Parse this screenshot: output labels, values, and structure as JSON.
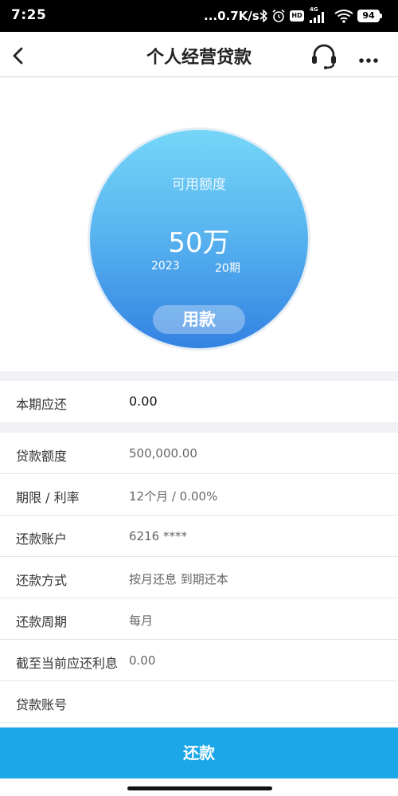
{
  "status_bar": {
    "time": "7:25",
    "net_speed": "...0.7K/s",
    "hd": "HD",
    "network": "4G",
    "battery": "94"
  },
  "header": {
    "title": "个人经营贷款",
    "back_icon": "chevron-left-icon",
    "support_icon": "headset-icon",
    "more_icon": "more-horizontal-icon"
  },
  "hero": {
    "label": "可用额度",
    "amount": "50万",
    "date_start": "2023",
    "date_end": "20期",
    "use_button": "用款"
  },
  "current_due": {
    "label": "本期应还",
    "value": "0.00"
  },
  "details": [
    {
      "label": "贷款额度",
      "value": "500,000.00"
    },
    {
      "label": "期限 / 利率",
      "value": "12个月 / 0.00%"
    },
    {
      "label": "还款账户",
      "value": "6216 ****"
    },
    {
      "label": "还款方式",
      "value": "按月还息 到期还本"
    },
    {
      "label": "还款周期",
      "value": "每月"
    },
    {
      "label": "截至当前应还利息",
      "value": "0.00"
    },
    {
      "label": "贷款账号"
    }
  ],
  "footer": {
    "repay_button": "还款"
  },
  "colors": {
    "accent": "#1ba7e8",
    "circle_top": "#76d6f8",
    "circle_bottom": "#3382e2",
    "separator": "#f0f0f5"
  }
}
